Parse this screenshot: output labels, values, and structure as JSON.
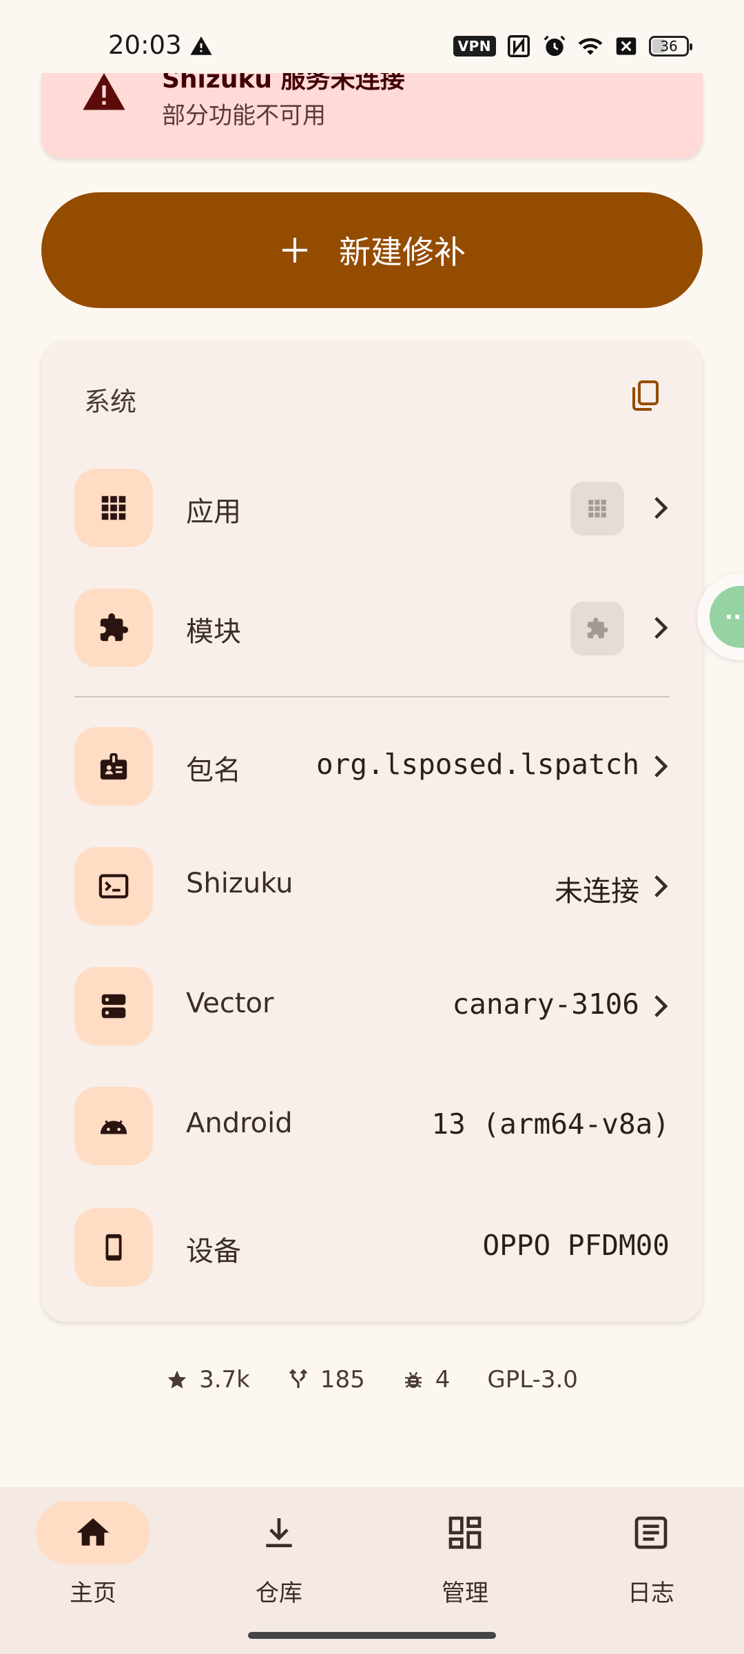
{
  "status_bar": {
    "time": "20:03",
    "vpn": "VPN",
    "battery": "36",
    "icons": [
      "warning-icon",
      "vpn-badge",
      "nfc-icon",
      "alarm-icon",
      "wifi-icon",
      "sim-off-icon",
      "battery-icon"
    ]
  },
  "warning": {
    "title": "Shizuku 服务未连接",
    "subtitle": "部分功能不可用",
    "color": "#ffdad7"
  },
  "new_patch": {
    "label": "新建修补",
    "color": "#944c00"
  },
  "system": {
    "title": "系统",
    "rows": [
      {
        "label": "应用",
        "icon": "apps-grid-icon"
      },
      {
        "label": "模块",
        "icon": "puzzle-icon"
      },
      {
        "label": "包名",
        "value": "org.lsposed.lspatch",
        "icon": "badge-icon"
      },
      {
        "label": "Shizuku",
        "value": "未连接",
        "icon": "terminal-icon"
      },
      {
        "label": "Vector",
        "value": "canary-3106",
        "icon": "storage-icon"
      },
      {
        "label": "Android",
        "value": "13 (arm64-v8a)",
        "icon": "android-icon"
      },
      {
        "label": "设备",
        "value": "OPPO PFDM00",
        "icon": "phone-icon"
      }
    ]
  },
  "stats": {
    "stars": "3.7k",
    "forks": "185",
    "issues": "4",
    "license": "GPL-3.0"
  },
  "nav": {
    "items": [
      {
        "label": "主页",
        "active": true
      },
      {
        "label": "仓库"
      },
      {
        "label": "管理"
      },
      {
        "label": "日志"
      }
    ]
  }
}
